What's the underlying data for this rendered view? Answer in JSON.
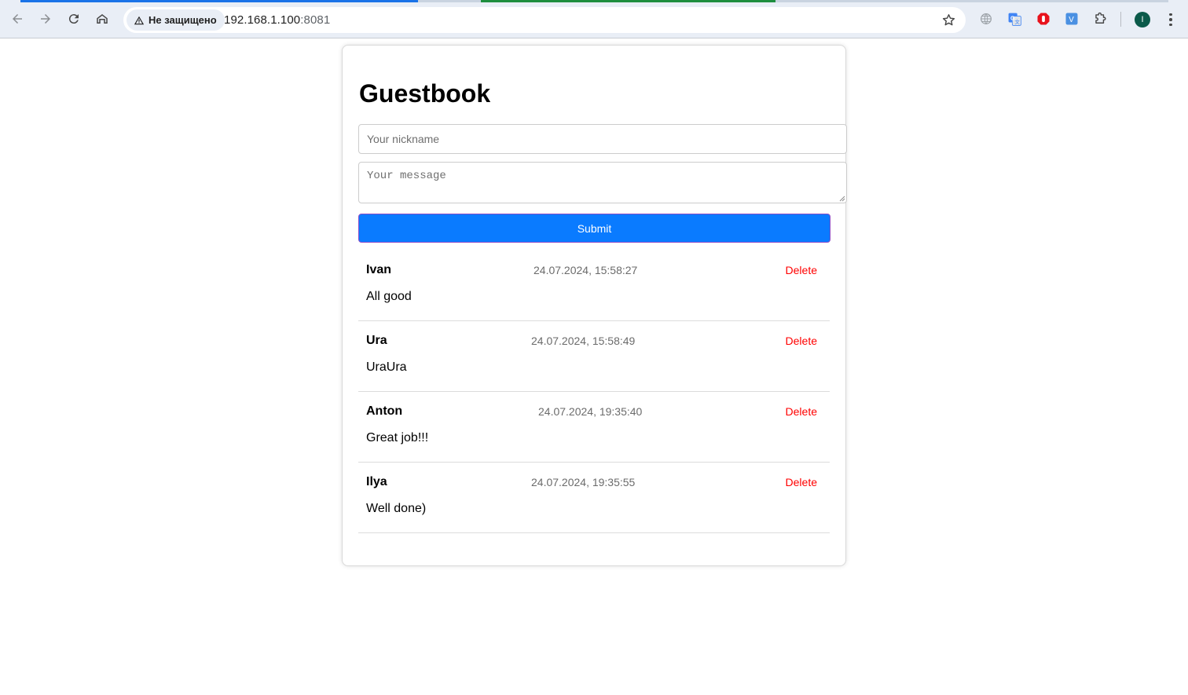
{
  "browser": {
    "security_label": "Не защищено",
    "url_host": "192.168.1.100",
    "url_port": ":8081",
    "profile_initial": "I",
    "tab_strip_colors": [
      "#1a73e8",
      "#c9d3e0",
      "#1e8e3e",
      "#c9d3e0"
    ]
  },
  "page": {
    "title": "Guestbook",
    "nickname_placeholder": "Your nickname",
    "message_placeholder": "Your message",
    "submit_label": "Submit",
    "delete_label": "Delete",
    "colors": {
      "submit_bg": "#0a7bff",
      "delete": "#ff0000"
    }
  },
  "entries": [
    {
      "nickname": "Ivan",
      "timestamp": "24.07.2024, 15:58:27",
      "message": "All good"
    },
    {
      "nickname": "Ura",
      "timestamp": "24.07.2024, 15:58:49",
      "message": "UraUra"
    },
    {
      "nickname": "Anton",
      "timestamp": "24.07.2024, 19:35:40",
      "message": "Great job!!!"
    },
    {
      "nickname": "Ilya",
      "timestamp": "24.07.2024, 19:35:55",
      "message": "Well done)"
    }
  ]
}
